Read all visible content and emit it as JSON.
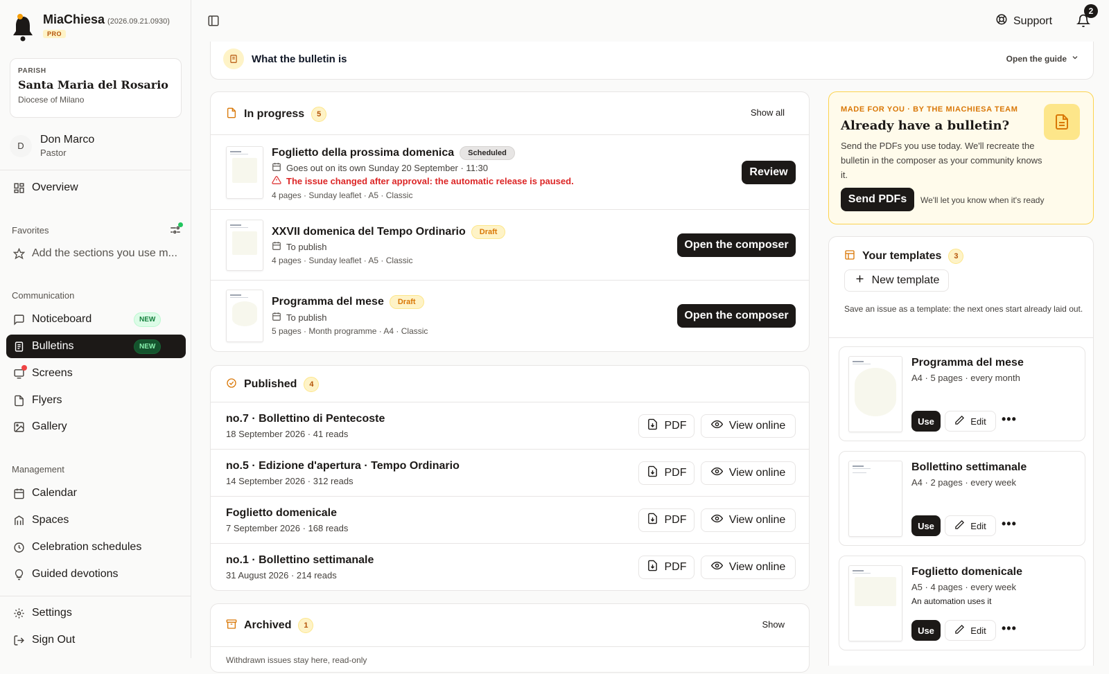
{
  "app": {
    "name": "MiaChiesa",
    "version": "(2026.09.21.0930)",
    "badge": "PRO"
  },
  "parish": {
    "label": "PARISH",
    "name": "Santa Maria del Rosario",
    "diocese": "Diocese of Milano"
  },
  "user": {
    "initial": "D",
    "name": "Don Marco",
    "role": "Pastor"
  },
  "nav": {
    "overview": "Overview",
    "favorites_label": "Favorites",
    "favorites_hint": "Add the sections you use m...",
    "communication_label": "Communication",
    "noticeboard": "Noticeboard",
    "bulletins": "Bulletins",
    "new_badge": "NEW",
    "screens": "Screens",
    "flyers": "Flyers",
    "gallery": "Gallery",
    "management_label": "Management",
    "calendar": "Calendar",
    "spaces": "Spaces",
    "celebrations": "Celebration schedules",
    "devotions": "Guided devotions",
    "settings": "Settings",
    "signout": "Sign Out"
  },
  "topbar": {
    "support": "Support",
    "notifications": "2"
  },
  "guide": {
    "title": "What the bulletin is",
    "action": "Open the guide"
  },
  "in_progress": {
    "title": "In progress",
    "count": "5",
    "show_all": "Show all",
    "items": [
      {
        "title": "Foglietto della prossima domenica",
        "status": "Scheduled",
        "schedule": "Goes out on its own Sunday 20 September · 11:30",
        "warning": "The issue changed after approval: the automatic release is paused.",
        "details": "4 pages · Sunday leaflet · A5 · Classic",
        "action": "Review"
      },
      {
        "title": "XXVII domenica del Tempo Ordinario",
        "status": "Draft",
        "schedule": "To publish",
        "details": "4 pages · Sunday leaflet · A5 · Classic",
        "action": "Open the composer"
      },
      {
        "title": "Programma del mese",
        "status": "Draft",
        "schedule": "To publish",
        "details": "5 pages · Month programme · A4 · Classic",
        "action": "Open the composer"
      }
    ]
  },
  "published": {
    "title": "Published",
    "count": "4",
    "pdf": "PDF",
    "view": "View online",
    "items": [
      {
        "title": "no.7 · Bollettino di Pentecoste",
        "sub": "18 September 2026 · 41 reads"
      },
      {
        "title": "no.5 · Edizione d'apertura · Tempo Ordinario",
        "sub": "14 September 2026 · 312 reads"
      },
      {
        "title": "Foglietto domenicale",
        "sub": "7 September 2026 · 168 reads"
      },
      {
        "title": "no.1 · Bollettino settimanale",
        "sub": "31 August 2026 · 214 reads"
      }
    ]
  },
  "archived": {
    "title": "Archived",
    "count": "1",
    "show": "Show",
    "hint": "Withdrawn issues stay here, read-only"
  },
  "promo": {
    "kicker": "MADE FOR YOU · BY THE MIACHIESA TEAM",
    "title": "Already have a bulletin?",
    "body": "Send the PDFs you use today. We'll recreate the bulletin in the composer as your community knows it.",
    "button": "Send PDFs",
    "note": "We'll let you know when it's ready"
  },
  "templates": {
    "title": "Your templates",
    "count": "3",
    "new": "New template",
    "hint": "Save an issue as a template: the next ones start already laid out.",
    "use": "Use",
    "edit": "Edit",
    "items": [
      {
        "name": "Programma del mese",
        "sub": "A4 · 5 pages · every month",
        "note": ""
      },
      {
        "name": "Bollettino settimanale",
        "sub": "A4 · 2 pages · every week",
        "note": ""
      },
      {
        "name": "Foglietto domenicale",
        "sub": "A5 · 4 pages · every week",
        "note": "An automation uses it"
      }
    ]
  },
  "colors": {
    "accent": "#1c1917",
    "warning": "#dc2626",
    "amber": "#d97706",
    "success": "#22c55e"
  }
}
